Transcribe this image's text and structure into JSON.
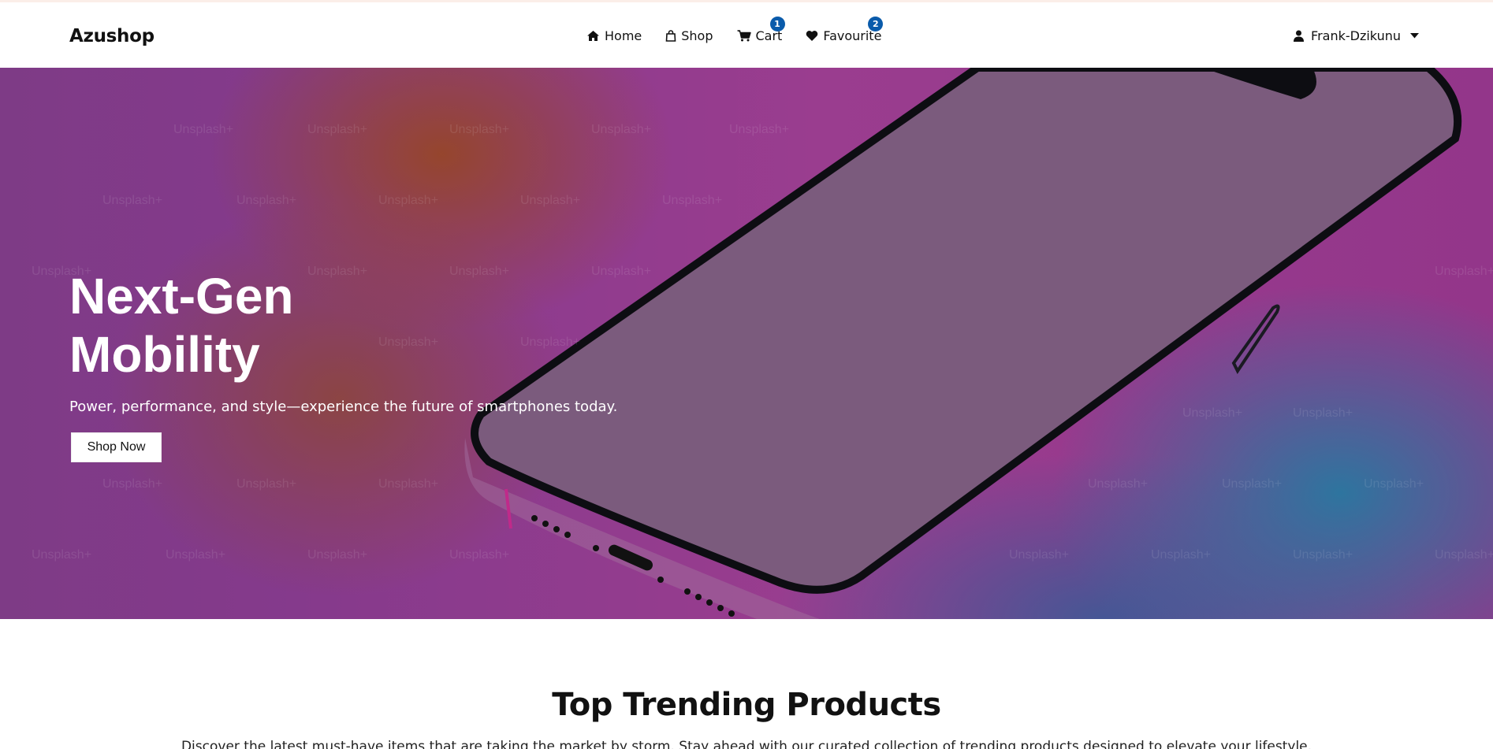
{
  "navbar": {
    "brand": "Azushop",
    "links": [
      {
        "label": "Home",
        "icon": "home-icon"
      },
      {
        "label": "Shop",
        "icon": "shopping-bag-icon"
      },
      {
        "label": "Cart",
        "icon": "cart-icon",
        "badge": "1"
      },
      {
        "label": "Favourite",
        "icon": "heart-icon",
        "badge": "2"
      }
    ],
    "user": {
      "name": "Frank-Dzikunu",
      "icon": "user-icon"
    }
  },
  "hero": {
    "title_line1": "Next-Gen",
    "title_line2": "Mobility",
    "subtitle": "Power, performance, and style—experience the future of smartphones today.",
    "button_label": "Shop Now",
    "watermark_text": "Unsplash+"
  },
  "trending": {
    "title": "Top Trending Products",
    "description": "Discover the latest must-have items that are taking the market by storm. Stay ahead with our curated collection of trending products designed to elevate your lifestyle."
  },
  "colors": {
    "badge": "#0a5bab",
    "text": "#111111",
    "hero_text": "#ffffff"
  }
}
